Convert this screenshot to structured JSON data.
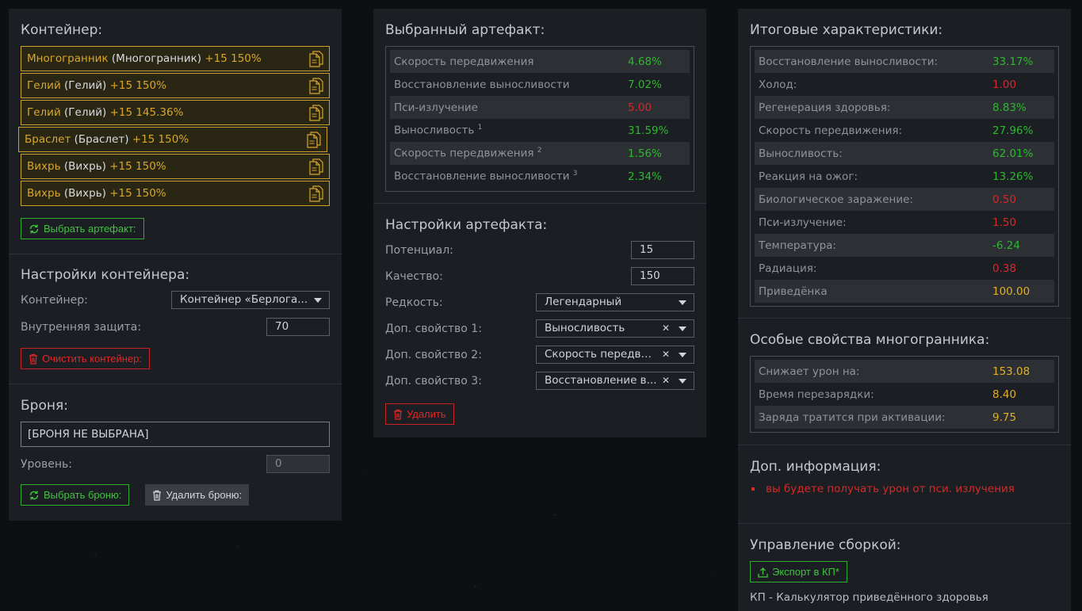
{
  "left": {
    "container_title": "Контейнер:",
    "items": [
      {
        "name": "Многогранник",
        "sub": "(Многогранник)",
        "bonus": "+15 150%"
      },
      {
        "name": "Гелий",
        "sub": "(Гелий)",
        "bonus": "+15 150%"
      },
      {
        "name": "Гелий",
        "sub": "(Гелий)",
        "bonus": "+15 145.36%"
      },
      {
        "name": "Браслет",
        "sub": "(Браслет)",
        "bonus": "+15 150%"
      },
      {
        "name": "Вихрь",
        "sub": "(Вихрь)",
        "bonus": "+15 150%"
      },
      {
        "name": "Вихрь",
        "sub": "(Вихрь)",
        "bonus": "+15 150%"
      }
    ],
    "select_artifact_btn": "Выбрать артефакт:",
    "container_settings_title": "Настройки контейнера:",
    "container_label": "Контейнер:",
    "container_value": "Контейнер «Берлога...",
    "inner_protection_label": "Внутренняя защита:",
    "inner_protection_value": "70",
    "clear_container_btn": "Очистить контейнер:",
    "armor_title": "Броня:",
    "armor_value": "[БРОНЯ НЕ ВЫБРАНА]",
    "level_label": "Уровень:",
    "level_value": "0",
    "select_armor_btn": "Выбрать броню:",
    "delete_armor_btn": "Удалить броню:"
  },
  "middle": {
    "selected_title": "Выбранный артефакт:",
    "stats": [
      {
        "label": "Скорость передвижения",
        "sup": "",
        "value": "4.68%",
        "color": "green"
      },
      {
        "label": "Восстановление выносливости",
        "sup": "",
        "value": "7.02%",
        "color": "green"
      },
      {
        "label": "Пси-излучение",
        "sup": "",
        "value": "5.00",
        "color": "red"
      },
      {
        "label": "Выносливость",
        "sup": "1",
        "value": "31.59%",
        "color": "green"
      },
      {
        "label": "Скорость передвижения",
        "sup": "2",
        "value": "1.56%",
        "color": "green"
      },
      {
        "label": "Восстановление выносливости",
        "sup": "3",
        "value": "2.34%",
        "color": "green"
      }
    ],
    "settings_title": "Настройки артефакта:",
    "potential_label": "Потенциал:",
    "potential_value": "15",
    "quality_label": "Качество:",
    "quality_value": "150",
    "rarity_label": "Редкость:",
    "rarity_value": "Легендарный",
    "extra1_label": "Доп. свойство 1:",
    "extra1_value": "Выносливость",
    "extra2_label": "Доп. свойство 2:",
    "extra2_value": "Скорость передви...",
    "extra3_label": "Доп. свойство 3:",
    "extra3_value": "Восстановление в...",
    "delete_btn": "Удалить"
  },
  "right": {
    "totals_title": "Итоговые характеристики:",
    "totals": [
      {
        "label": "Восстановление выносливости:",
        "value": "33.17%",
        "color": "green"
      },
      {
        "label": "Холод:",
        "value": "1.00",
        "color": "red"
      },
      {
        "label": "Регенерация здоровья:",
        "value": "8.83%",
        "color": "green"
      },
      {
        "label": "Скорость передвижения:",
        "value": "27.96%",
        "color": "green"
      },
      {
        "label": "Выносливость:",
        "value": "62.01%",
        "color": "green"
      },
      {
        "label": "Реакция на ожог:",
        "value": "13.26%",
        "color": "green"
      },
      {
        "label": "Биологическое заражение:",
        "value": "0.50",
        "color": "red"
      },
      {
        "label": "Пси-излучение:",
        "value": "1.50",
        "color": "red"
      },
      {
        "label": "Температура:",
        "value": "-6.24",
        "color": "green"
      },
      {
        "label": "Радиация:",
        "value": "0.38",
        "color": "red"
      },
      {
        "label": "Приведёнка",
        "value": "100.00",
        "color": "gold"
      }
    ],
    "special_title": "Особые свойства многогранника:",
    "special": [
      {
        "label": "Снижает урон на:",
        "value": "153.08"
      },
      {
        "label": "Время перезарядки:",
        "value": "8.40"
      },
      {
        "label": "Заряда тратится при активации:",
        "value": "9.75"
      }
    ],
    "info_title": "Доп. информация:",
    "info_item": "вы будете получать урон от пси. излучения",
    "build_title": "Управление сборкой:",
    "export_btn": "Экспорт в КП*",
    "footnote": "КП - Калькулятор приведённого здоровья"
  },
  "colors": {
    "green": "#2eb82e",
    "red": "#d42a2a",
    "gold": "#e0b02a",
    "panel": "#1b1e22"
  }
}
